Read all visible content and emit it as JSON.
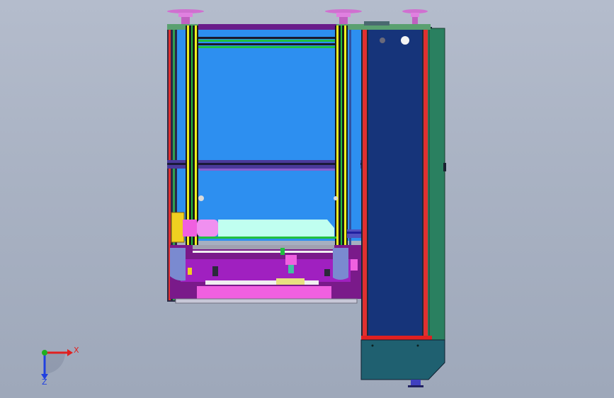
{
  "triad": {
    "x_label": "X",
    "z_label": "Z",
    "x_color": "#e02020",
    "y_color": "#20b020",
    "z_color": "#2040e0"
  },
  "colors": {
    "background": "#aab3c4",
    "frame_blue": "#2d8ff0",
    "panel_navy": "#16347a",
    "bed_purple": "#a020c0",
    "rail_yellow": "#f0f020",
    "rail_green": "#20c040",
    "rail_red": "#e03030",
    "base_teal": "#1f6070",
    "side_green": "#2a8060",
    "pink": "#f060e0",
    "cyan": "#c0fff0"
  }
}
